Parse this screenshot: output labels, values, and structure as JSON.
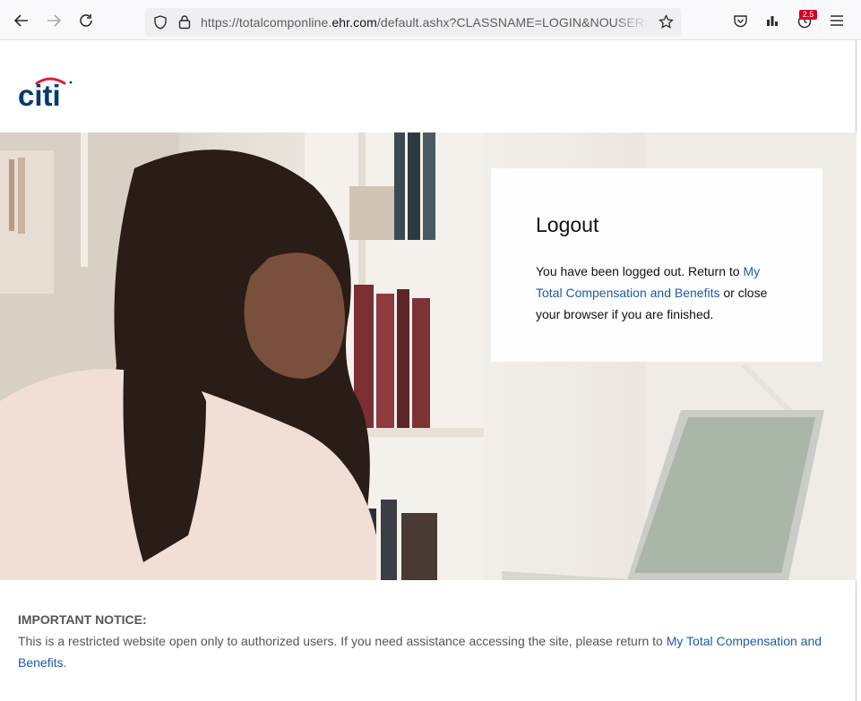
{
  "browser": {
    "url_prefix": "https://totalcomponline.",
    "url_host": "ehr.com",
    "url_suffix": "/default.ashx?CLASSNAME=LOGIN&NOUSER=TRUE",
    "extension_badge": "2.5"
  },
  "header": {
    "logo_text": "citi"
  },
  "logout_card": {
    "title": "Logout",
    "text_before_link": "You have been logged out. Return to ",
    "link_text": "My Total Compensation and Benefits",
    "text_after_link": " or close your browser if you are finished."
  },
  "notice": {
    "title": "IMPORTANT NOTICE:",
    "text_before_link": "This is a restricted website open only to authorized users. If you need assistance accessing the site, please return to ",
    "link_text": "My Total Compensation and Benefits",
    "text_after_link": "."
  },
  "colors": {
    "brand_blue": "#003b70",
    "brand_red": "#e31937",
    "link": "#1f5aa8"
  }
}
